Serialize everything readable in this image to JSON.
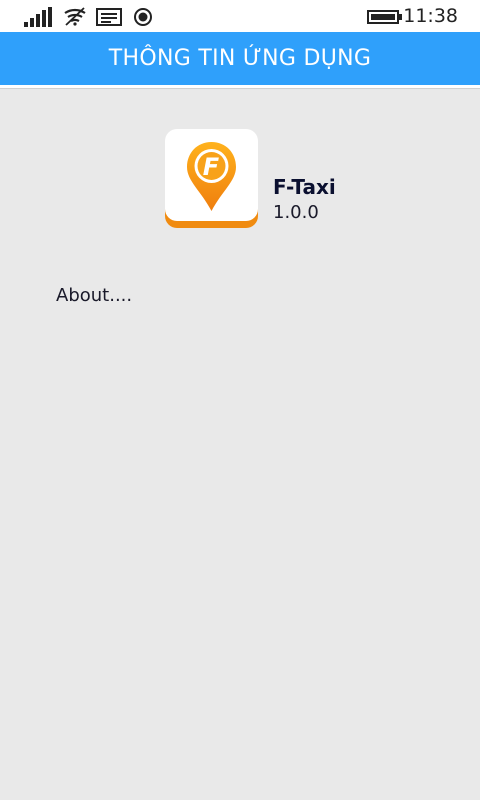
{
  "status_bar": {
    "time": "11:38",
    "icons": [
      "signal-icon",
      "wifi-icon",
      "message-icon",
      "location-icon",
      "battery-icon"
    ]
  },
  "header": {
    "title": "THÔNG TIN ỨNG DỤNG",
    "background_color": "#2fa0fb"
  },
  "app_info": {
    "icon": "f-taxi-logo-icon",
    "name": "F-Taxi",
    "version": "1.0.0",
    "accent_color": "#f59a16"
  },
  "about": {
    "text": "About...."
  },
  "colors": {
    "background": "#e9e9e9",
    "header": "#2fa0fb"
  }
}
